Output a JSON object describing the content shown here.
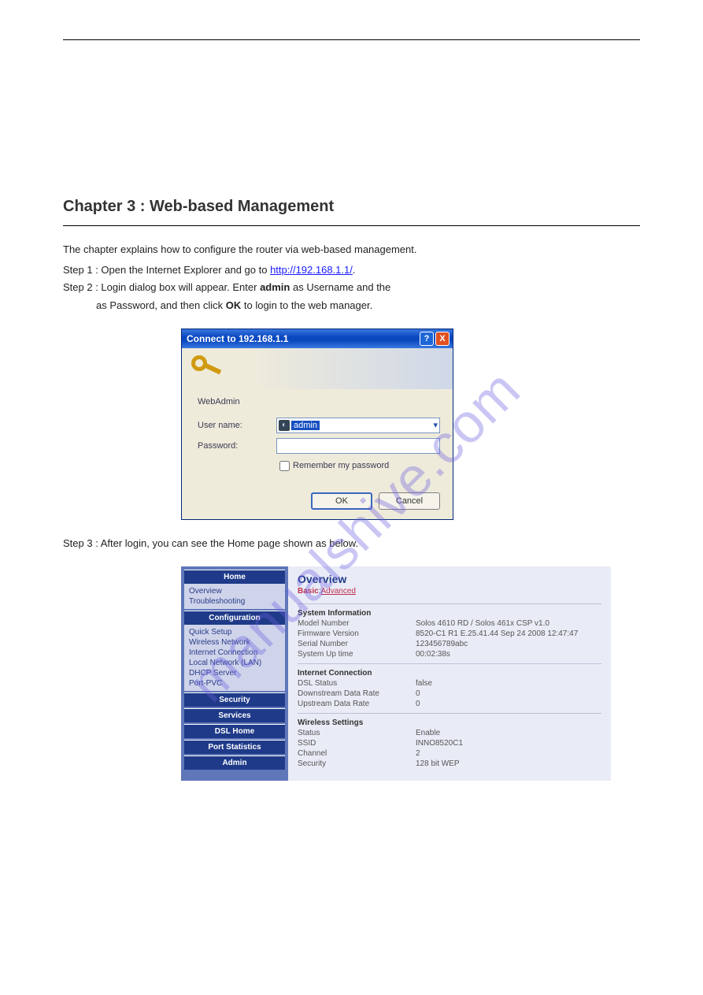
{
  "watermark": "manualshive.com",
  "chapter": {
    "title": "Chapter 3 : Web-based Management",
    "intro": "The chapter explains how to configure the router via web-based management.",
    "step1_a": "Step 1 : Open the Internet Explorer and go to ",
    "step1_url": "http://192.168.1.1/",
    "step1_b": ".",
    "step2_a": "Step 2 : Login dialog box will appear. Enter ",
    "admin_word": "admin",
    "step2_b": " as Username and the",
    "step2_c": "as Password, and then click",
    "ok_word": "OK",
    "step2_d": " to login to the web manager."
  },
  "dialog": {
    "title": "Connect to 192.168.1.1",
    "realm": "WebAdmin",
    "username_label": "User name:",
    "password_label": "Password:",
    "username_value": "admin",
    "remember_label": "Remember my password",
    "ok": "OK",
    "cancel": "Cancel"
  },
  "between_text": "Step 3 : After login, you can see the Home page shown as below.",
  "overview": {
    "title": "Overview",
    "tab_basic": "Basic",
    "tab_sep": ":",
    "tab_adv": "Advanced",
    "sidebar": {
      "home": "Home",
      "home_items": [
        "Overview",
        "Troubleshooting"
      ],
      "config": "Configuration",
      "config_items": [
        "Quick Setup",
        "Wireless Network",
        "Internet Connection",
        "Local Network (LAN)",
        "DHCP Server",
        "Port-PVC"
      ],
      "sections": [
        "Security",
        "Services",
        "DSL Home",
        "Port Statistics",
        "Admin"
      ]
    },
    "sys_head": "System Information",
    "sys_rows": [
      [
        "Model Number",
        "Solos 4610 RD / Solos 461x CSP v1.0"
      ],
      [
        "Firmware Version",
        "8520-C1 R1 E.25.41.44 Sep 24 2008 12:47:47"
      ],
      [
        "Serial Number",
        "123456789abc"
      ],
      [
        "System Up time",
        "00:02:38s"
      ]
    ],
    "net_head": "Internet Connection",
    "net_rows": [
      [
        "DSL Status",
        "false"
      ],
      [
        "Downstream Data Rate",
        "0"
      ],
      [
        "Upstream Data Rate",
        "0"
      ]
    ],
    "wl_head": "Wireless Settings",
    "wl_rows": [
      [
        "Status",
        "Enable"
      ],
      [
        "SSID",
        "INNO8520C1"
      ],
      [
        "Channel",
        "2"
      ],
      [
        "Security",
        "128 bit WEP"
      ]
    ]
  }
}
